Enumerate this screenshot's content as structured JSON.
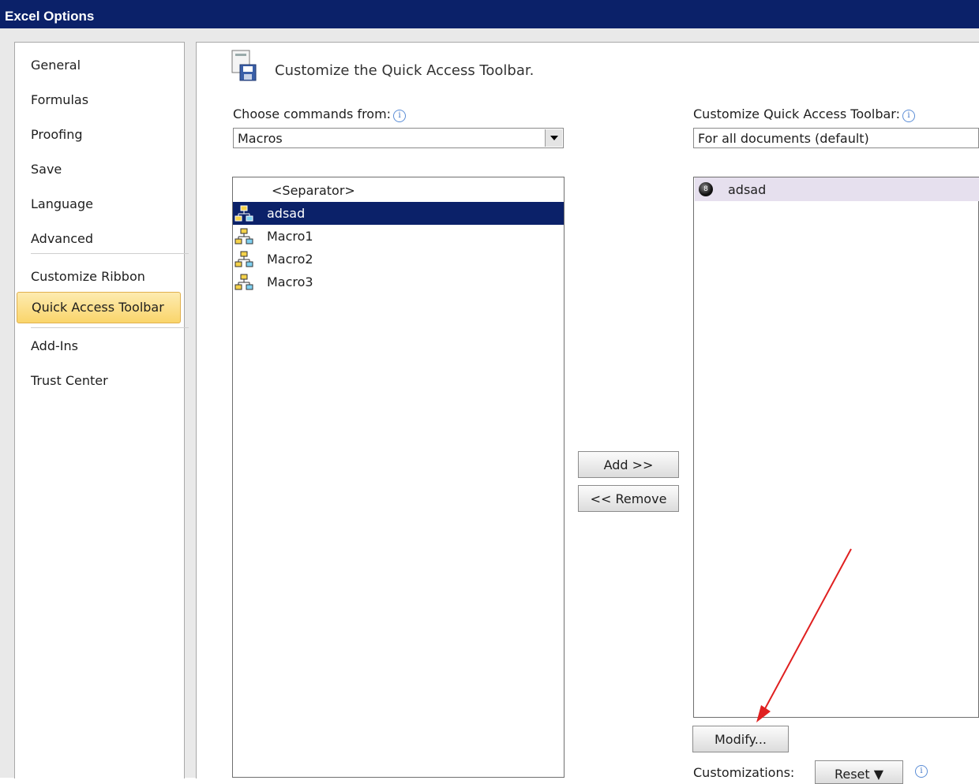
{
  "window": {
    "title": "Excel Options"
  },
  "nav": {
    "items": [
      {
        "label": "General"
      },
      {
        "label": "Formulas"
      },
      {
        "label": "Proofing"
      },
      {
        "label": "Save"
      },
      {
        "label": "Language"
      },
      {
        "label": "Advanced"
      },
      {
        "label": "Customize Ribbon"
      },
      {
        "label": "Quick Access Toolbar",
        "selected": true
      },
      {
        "label": "Add-Ins"
      },
      {
        "label": "Trust Center"
      }
    ]
  },
  "main": {
    "heading": "Customize the Quick Access Toolbar.",
    "choose_label": "Choose commands from:",
    "choose_value": "Macros",
    "customize_label": "Customize Quick Access Toolbar:",
    "customize_value": "For all documents (default)",
    "commands": [
      {
        "label": "<Separator>",
        "icon": "separator"
      },
      {
        "label": "adsad",
        "icon": "macro-icon",
        "selected": true
      },
      {
        "label": "Macro1",
        "icon": "macro-icon"
      },
      {
        "label": "Macro2",
        "icon": "macro-icon"
      },
      {
        "label": "Macro3",
        "icon": "macro-icon"
      }
    ],
    "add_button": "Add >>",
    "remove_button": "<< Remove",
    "toolbar_items": [
      {
        "label": "adsad",
        "icon": "macro-ball-icon"
      }
    ],
    "modify_button": "Modify...",
    "customizations_label": "Customizations:",
    "reset_button": "Reset ▼"
  },
  "colors": {
    "title_bar": "#0b2169",
    "selection": "#0b2169",
    "nav_selected": "#fad56b"
  }
}
